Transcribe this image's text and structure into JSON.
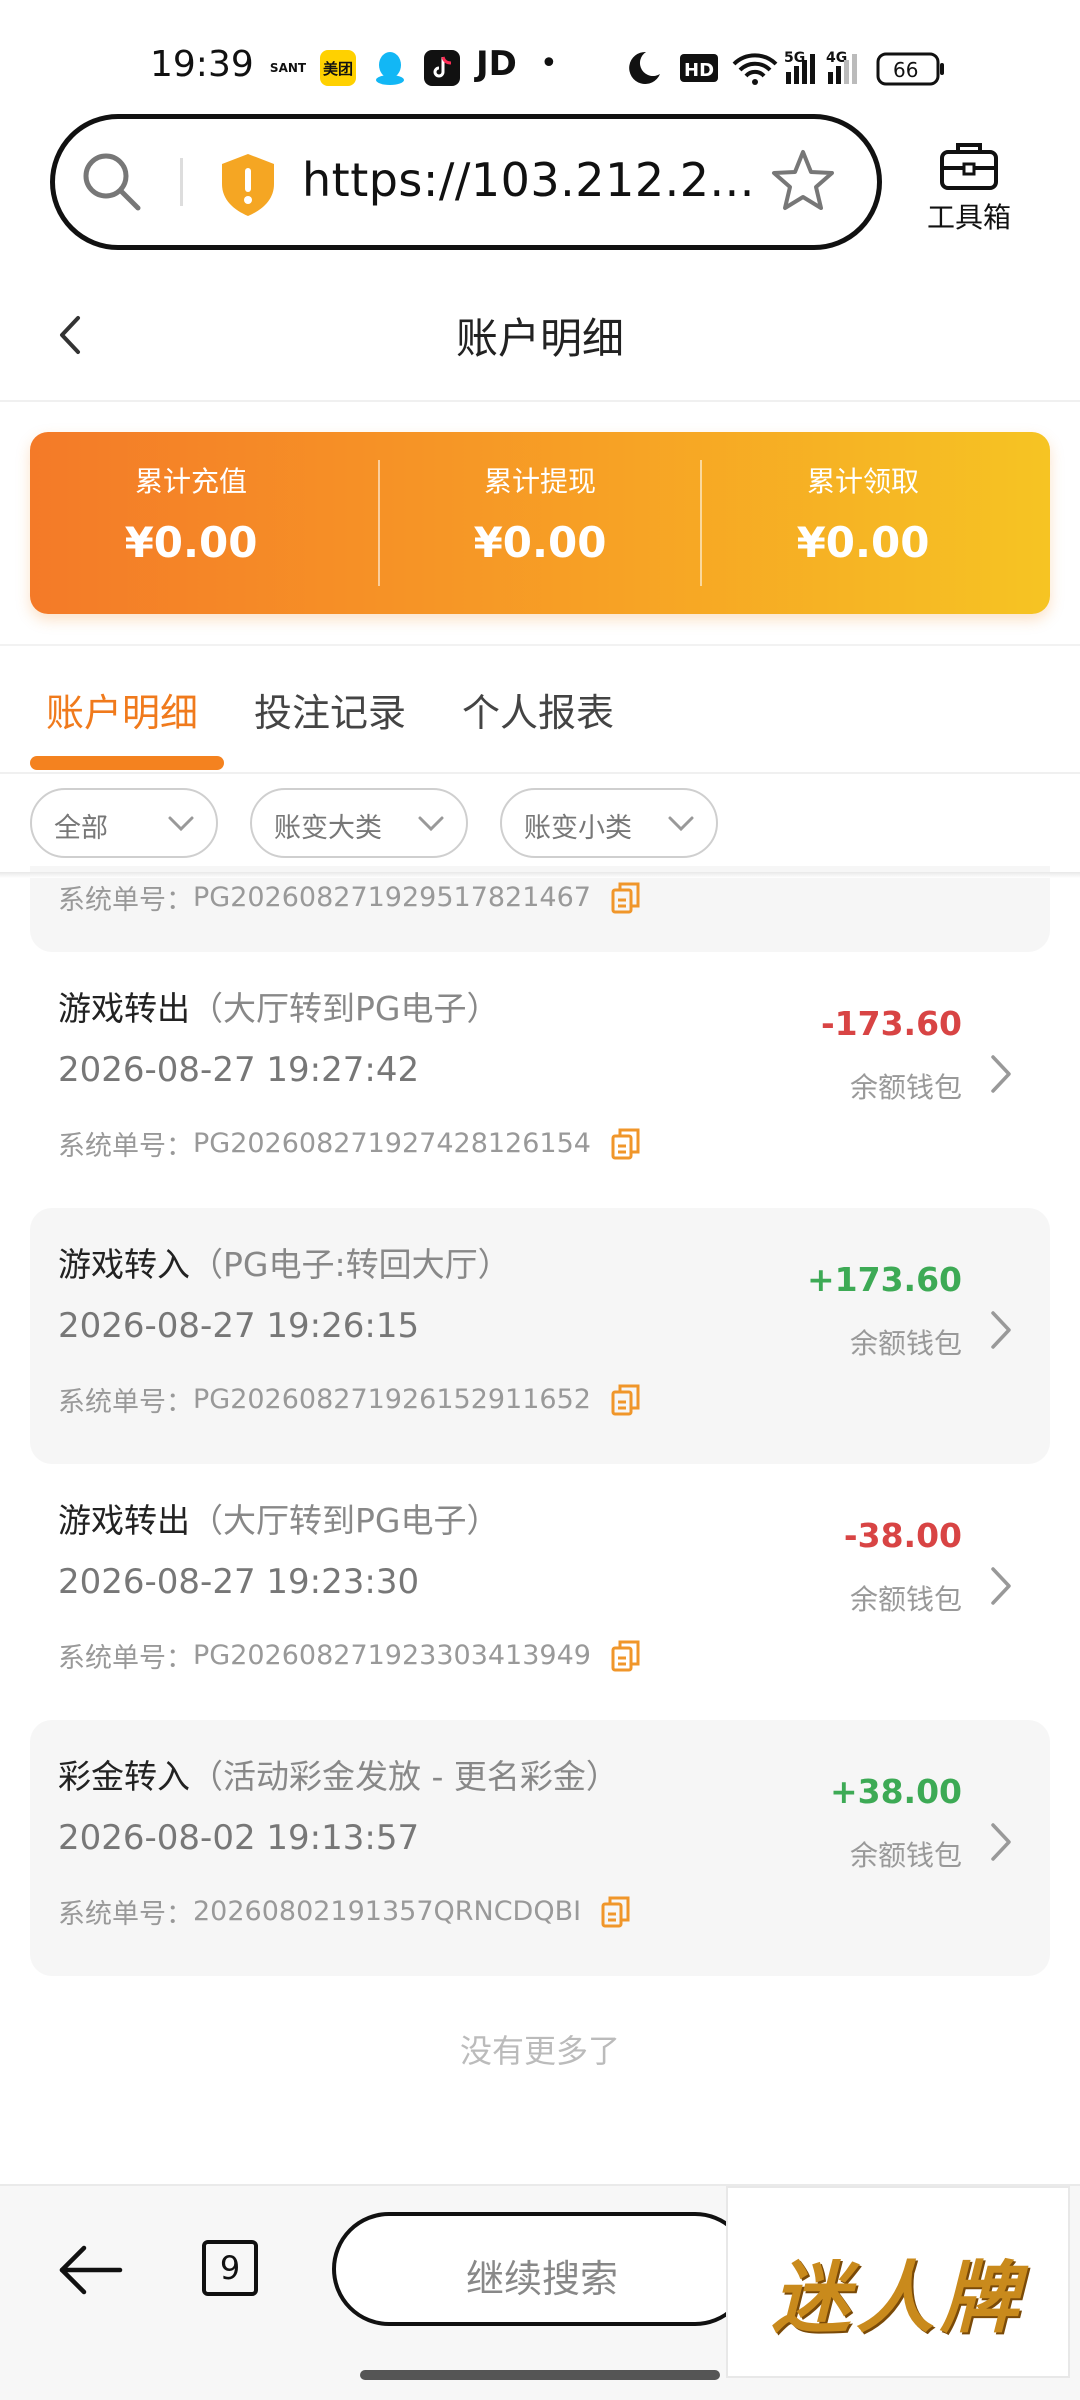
{
  "status_bar": {
    "time": "19:39",
    "apps": [
      "SANT",
      "美团",
      "QQ",
      "TikTok",
      "JD"
    ],
    "network": "5G",
    "network2": "4G",
    "hd": "HD",
    "battery": "66"
  },
  "browser": {
    "url": "https://103.212.2...",
    "toolbox_label": "工具箱"
  },
  "page": {
    "title": "账户明细"
  },
  "summary": [
    {
      "label": "累计充值",
      "value": "¥0.00"
    },
    {
      "label": "累计提现",
      "value": "¥0.00"
    },
    {
      "label": "累计领取",
      "value": "¥0.00"
    }
  ],
  "tabs": [
    {
      "label": "账户明细",
      "active": true
    },
    {
      "label": "投注记录",
      "active": false
    },
    {
      "label": "个人报表",
      "active": false
    }
  ],
  "filters": [
    {
      "label": "全部"
    },
    {
      "label": "账变大类"
    },
    {
      "label": "账变小类"
    }
  ],
  "order_prefix": "系统单号：",
  "partial_record": {
    "order": "PG20260827192951782146​7"
  },
  "records": [
    {
      "title": "游戏转出",
      "sub": "（大厅转到PG电子）",
      "time": "2026-08-27 19:27:42",
      "order": "PG20260827192742812615​4",
      "amount": "-173.60",
      "wallet": "余额钱包"
    },
    {
      "title": "游戏转入",
      "sub": "（PG电子:转回大厅）",
      "time": "2026-08-27 19:26:15",
      "order": "PG20260827192615291165​2",
      "amount": "+173.60",
      "wallet": "余额钱包"
    },
    {
      "title": "游戏转出",
      "sub": "（大厅转到PG电子）",
      "time": "2026-08-27 19:23:30",
      "order": "PG20260827192330341394​9",
      "amount": "-38.00",
      "wallet": "余额钱包"
    },
    {
      "title": "彩金转入",
      "sub": "（活动彩金发放 - 更名彩金）",
      "time": "2026-08-02 19:13:57",
      "order": "20260802191357QRNCDQBI",
      "amount": "+38.00",
      "wallet": "余额钱包"
    }
  ],
  "no_more": "没有更多了",
  "bottom_nav": {
    "tab_count": "9",
    "search_label": "继续搜索",
    "watermark": "迷人牌"
  },
  "colors": {
    "accent": "#f4821f",
    "negative": "#d84444",
    "positive": "#3daa55"
  }
}
